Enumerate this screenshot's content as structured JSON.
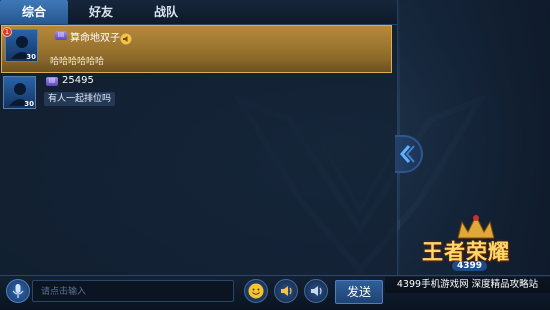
{
  "tabs": [
    {
      "label": "综合",
      "active": true
    },
    {
      "label": "好友",
      "active": false
    },
    {
      "label": "战队",
      "active": false
    }
  ],
  "messages": [
    {
      "sender": "算命地双子",
      "rank_badge": "III",
      "level": "30",
      "text": "哈哈哈哈哈哈",
      "selected": true,
      "alert": "1",
      "icon": "speaker-icon"
    },
    {
      "sender": "25495",
      "rank_badge": "III",
      "level": "30",
      "text": "有人一起排位吗",
      "selected": false
    }
  ],
  "input": {
    "placeholder": "请点击输入"
  },
  "send_label": "发送",
  "logo": {
    "title": "王者荣耀",
    "subtitle": "4399"
  },
  "watermark": "4399手机游戏网 深度精品攻略站",
  "colors": {
    "selected_bg": "#b68a3b",
    "accent": "#3f78b8",
    "logo_gold": "#ffd86a"
  }
}
